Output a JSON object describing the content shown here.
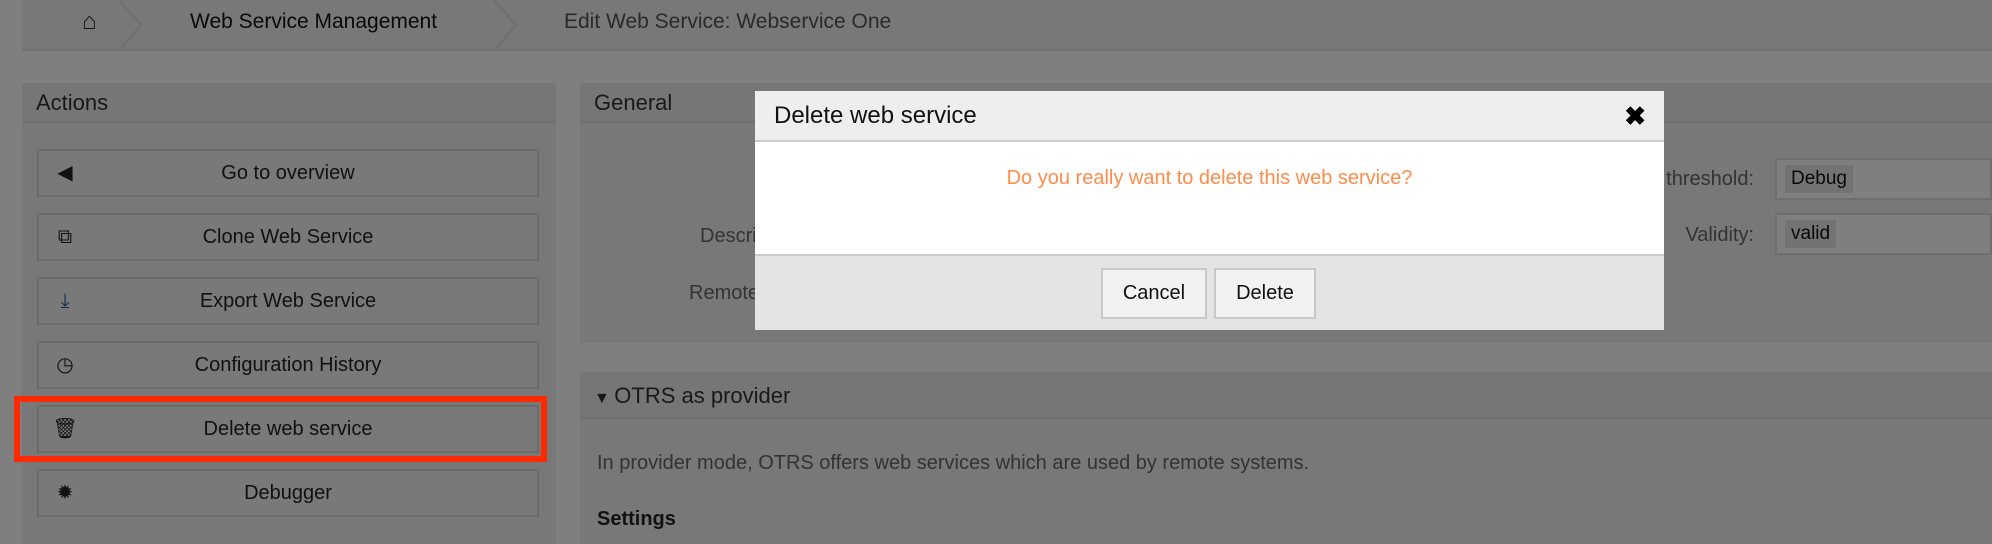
{
  "breadcrumb": {
    "home_icon": "home-icon",
    "items": [
      "Web Service Management",
      "Edit Web Service: Webservice One"
    ]
  },
  "actions": {
    "title": "Actions",
    "buttons": [
      {
        "label": "Go to overview",
        "icon": "caret-left-icon"
      },
      {
        "label": "Clone Web Service",
        "icon": "clone-icon"
      },
      {
        "label": "Export Web Service",
        "icon": "download-icon"
      },
      {
        "label": "Configuration History",
        "icon": "clock-icon"
      },
      {
        "label": "Delete web service",
        "icon": "trash-icon"
      },
      {
        "label": "Debugger",
        "icon": "bug-icon"
      }
    ]
  },
  "highlight_color": "#ff2a00",
  "general": {
    "title": "General",
    "labels": {
      "description": "Description:",
      "remote": "Remote system:",
      "debug": "Debug threshold:",
      "validity": "Validity:"
    },
    "debug_value": "Debug",
    "validity_value": "valid"
  },
  "provider": {
    "title": "OTRS as provider",
    "text": "In provider mode, OTRS offers web services which are used by remote systems.",
    "settings": "Settings"
  },
  "modal": {
    "title": "Delete web service",
    "close_icon": "close-icon",
    "message": "Do you really want to delete this web service?",
    "message_color": "#ff8c4a",
    "cancel": "Cancel",
    "delete": "Delete"
  }
}
